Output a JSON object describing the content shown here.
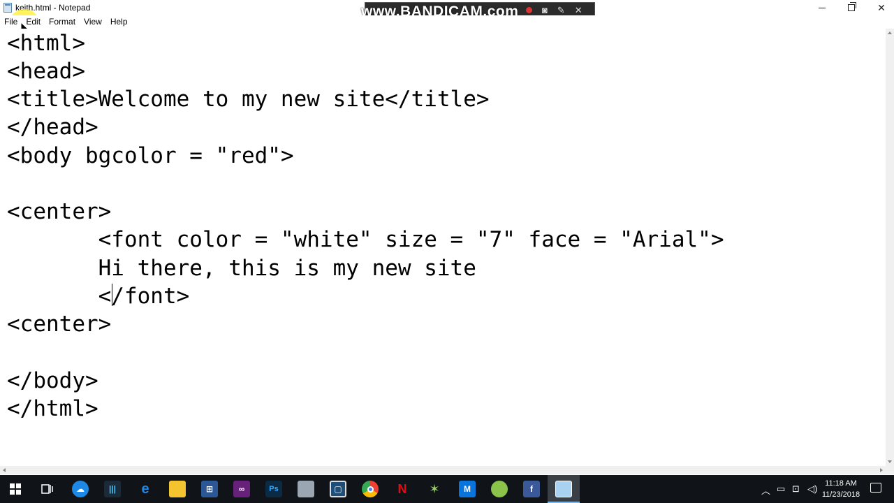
{
  "window": {
    "title": "keith.html - Notepad"
  },
  "overlay": {
    "watermark": "www.BANDICAM.com"
  },
  "menu": {
    "items": [
      "File",
      "Edit",
      "Format",
      "View",
      "Help"
    ]
  },
  "editor": {
    "lines": [
      "<html>",
      "<head>",
      "<title>Welcome to my new site</title>",
      "</head>",
      "<body bgcolor = \"red\">",
      "",
      "<center>",
      "       <font color = \"white\" size = \"7\" face = \"Arial\">",
      "       Hi there, this is my new site",
      "       </font>",
      "<center>",
      "",
      "</body>",
      "</html>"
    ]
  },
  "taskbar": {
    "time": "11:18 AM",
    "date": "11/23/2018",
    "apps": [
      "windows-start-icon",
      "task-view-icon",
      "cloud-app-icon",
      "audio-app-icon",
      "edge-icon",
      "file-explorer-icon",
      "store-icon",
      "visual-studio-icon",
      "photoshop-icon",
      "folder-stack-icon",
      "code-app-icon",
      "chrome-icon",
      "netflix-icon",
      "star-app-icon",
      "outlook-icon",
      "notepad-plus-icon",
      "facebook-icon",
      "notepad-icon"
    ]
  },
  "colors": {
    "highlight": "#ffef28",
    "taskbar": "#101418"
  }
}
